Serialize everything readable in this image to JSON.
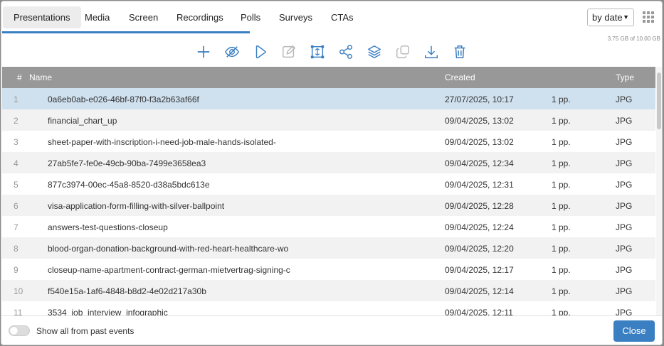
{
  "tabs": [
    {
      "label": "Presentations",
      "active": true
    },
    {
      "label": "Media"
    },
    {
      "label": "Screen"
    },
    {
      "label": "Recordings"
    },
    {
      "label": "Polls"
    },
    {
      "label": "Surveys"
    },
    {
      "label": "CTAs"
    }
  ],
  "sort": {
    "selected": "by date"
  },
  "storage": "3.75 GB of 10.00 GB",
  "toolbar_icons": [
    "add-icon",
    "eye-off-icon",
    "play-icon",
    "edit-icon",
    "resize-icon",
    "share-icon",
    "layers-icon",
    "duplicate-icon",
    "download-icon",
    "trash-icon"
  ],
  "colors": {
    "accent": "#3a7fc2",
    "header_bg": "#989898",
    "selected_row": "#cfe0ee",
    "disabled_icon": "#b8b8b8"
  },
  "table": {
    "columns": {
      "num": "#",
      "name": "Name",
      "created": "Created",
      "type": "Type"
    },
    "rows": [
      {
        "num": "1",
        "name": "0a6eb0ab-e026-46bf-87f0-f3a2b63af66f",
        "created": "27/07/2025, 10:17",
        "pages": "1 pp.",
        "type": "JPG",
        "selected": true
      },
      {
        "num": "2",
        "name": "financial_chart_up",
        "created": "09/04/2025, 13:02",
        "pages": "1 pp.",
        "type": "JPG"
      },
      {
        "num": "3",
        "name": "sheet-paper-with-inscription-i-need-job-male-hands-isolated-",
        "created": "09/04/2025, 13:02",
        "pages": "1 pp.",
        "type": "JPG"
      },
      {
        "num": "4",
        "name": "27ab5fe7-fe0e-49cb-90ba-7499e3658ea3",
        "created": "09/04/2025, 12:34",
        "pages": "1 pp.",
        "type": "JPG"
      },
      {
        "num": "5",
        "name": "877c3974-00ec-45a8-8520-d38a5bdc613e",
        "created": "09/04/2025, 12:31",
        "pages": "1 pp.",
        "type": "JPG"
      },
      {
        "num": "6",
        "name": "visa-application-form-filling-with-silver-ballpoint",
        "created": "09/04/2025, 12:28",
        "pages": "1 pp.",
        "type": "JPG"
      },
      {
        "num": "7",
        "name": "answers-test-questions-closeup",
        "created": "09/04/2025, 12:24",
        "pages": "1 pp.",
        "type": "JPG"
      },
      {
        "num": "8",
        "name": "blood-organ-donation-background-with-red-heart-healthcare-wo",
        "created": "09/04/2025, 12:20",
        "pages": "1 pp.",
        "type": "JPG"
      },
      {
        "num": "9",
        "name": "closeup-name-apartment-contract-german-mietvertrag-signing-c",
        "created": "09/04/2025, 12:17",
        "pages": "1 pp.",
        "type": "JPG"
      },
      {
        "num": "10",
        "name": "f540e15a-1af6-4848-b8d2-4e02d217a30b",
        "created": "09/04/2025, 12:14",
        "pages": "1 pp.",
        "type": "JPG"
      },
      {
        "num": "11",
        "name": "3534_job_interview_infographic",
        "created": "09/04/2025, 12:11",
        "pages": "1 pp.",
        "type": "JPG"
      }
    ]
  },
  "footer": {
    "toggle_label": "Show all from past events",
    "toggle_on": false,
    "close_label": "Close"
  }
}
